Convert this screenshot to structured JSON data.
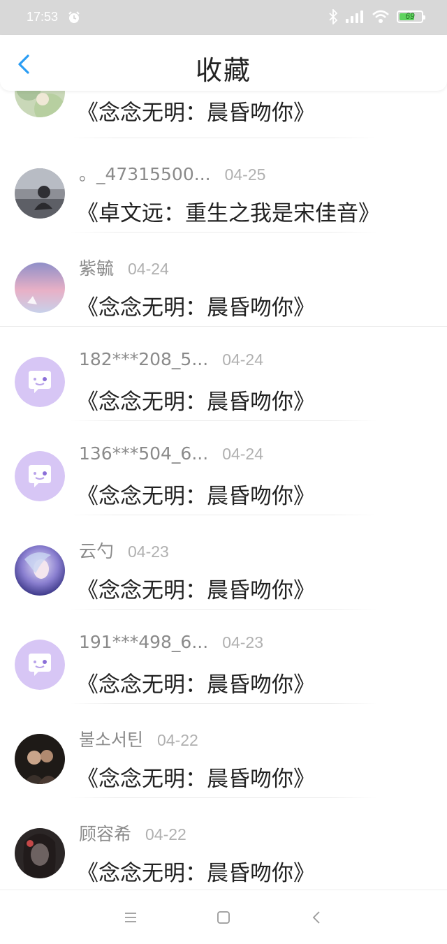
{
  "status_bar": {
    "time": "17:53",
    "battery": "69",
    "icons": [
      "alarm-icon",
      "bluetooth-icon",
      "signal-icon",
      "wifi-icon",
      "battery-icon"
    ]
  },
  "header": {
    "title": "收藏",
    "back_icon": "chevron-left-icon",
    "accent_color": "#2a9df4"
  },
  "items": [
    {
      "name": "",
      "date": "",
      "book": "《念念无明：晨昏吻你》",
      "avatar": "photo"
    },
    {
      "name": "。_47315500...",
      "date": "04-25",
      "book": "《卓文远：重生之我是宋佳音》",
      "avatar": "photo"
    },
    {
      "name": "紫毓",
      "date": "04-24",
      "book": "《念念无明：晨昏吻你》",
      "avatar": "photo"
    },
    {
      "name": "182***208_5...",
      "date": "04-24",
      "book": "《念念无明：晨昏吻你》",
      "avatar": "default"
    },
    {
      "name": "136***504_6...",
      "date": "04-24",
      "book": "《念念无明：晨昏吻你》",
      "avatar": "default"
    },
    {
      "name": "云勺",
      "date": "04-23",
      "book": "《念念无明：晨昏吻你》",
      "avatar": "photo"
    },
    {
      "name": "191***498_6...",
      "date": "04-23",
      "book": "《念念无明：晨昏吻你》",
      "avatar": "default"
    },
    {
      "name": "불소서틴",
      "date": "04-22",
      "book": "《念念无明：晨昏吻你》",
      "avatar": "photo"
    },
    {
      "name": "顾容希",
      "date": "04-22",
      "book": "《念念无明：晨昏吻你》",
      "avatar": "photo"
    }
  ],
  "nav_bar": {
    "icons": [
      "menu-icon",
      "home-icon",
      "back-icon"
    ]
  }
}
